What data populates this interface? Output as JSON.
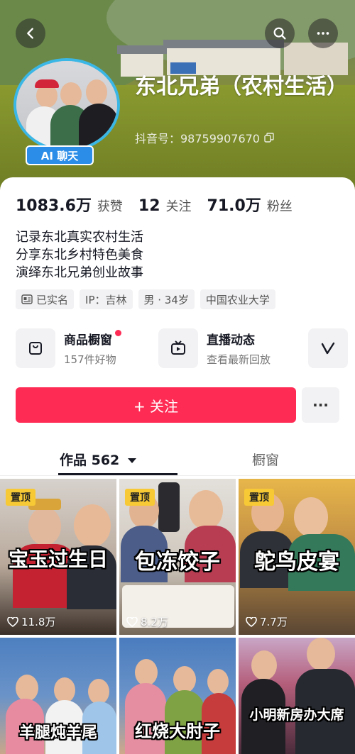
{
  "profile": {
    "name": "东北兄弟（农村生活）",
    "douyin_id_label": "抖音号：98759907670",
    "ai_chat_label": "AI 聊天"
  },
  "stats": [
    {
      "value": "1083.6万",
      "label": "获赞"
    },
    {
      "value": "12",
      "label": "关注"
    },
    {
      "value": "71.0万",
      "label": "粉丝"
    }
  ],
  "bio": [
    "记录东北真实农村生活",
    "分享东北乡村特色美食",
    "演绎东北兄弟创业故事"
  ],
  "tags": [
    {
      "label": "已实名",
      "icon": "id-card-icon"
    },
    {
      "label": "IP：吉林"
    },
    {
      "label": "男 · 34岁"
    },
    {
      "label": "中国农业大学"
    }
  ],
  "features": [
    {
      "title": "商品橱窗",
      "subtitle": "157件好物",
      "icon": "shopping-bag-icon"
    },
    {
      "title": "直播动态",
      "subtitle": "查看最新回放",
      "icon": "tv-icon"
    }
  ],
  "actions": {
    "follow_label": "+ 关注",
    "more_label": "···"
  },
  "tabs": {
    "works_label": "作品 562",
    "window_label": "橱窗"
  },
  "videos": [
    {
      "pinned": "置顶",
      "caption": "宝玉过生日",
      "likes": "11.8万"
    },
    {
      "pinned": "置顶",
      "caption": "包冻饺子",
      "likes": "8.2万"
    },
    {
      "pinned": "置顶",
      "caption": "鸵鸟皮宴",
      "likes": "7.7万"
    },
    {
      "caption": "羊腿炖羊尾"
    },
    {
      "caption": "红烧大肘子"
    },
    {
      "caption": "小明新房办大席"
    }
  ],
  "colors": {
    "accent": "#fe2c55",
    "avatar_ring": "#3bb7e6",
    "ai_badge": "#2b8de8",
    "pin": "#f7c935"
  }
}
